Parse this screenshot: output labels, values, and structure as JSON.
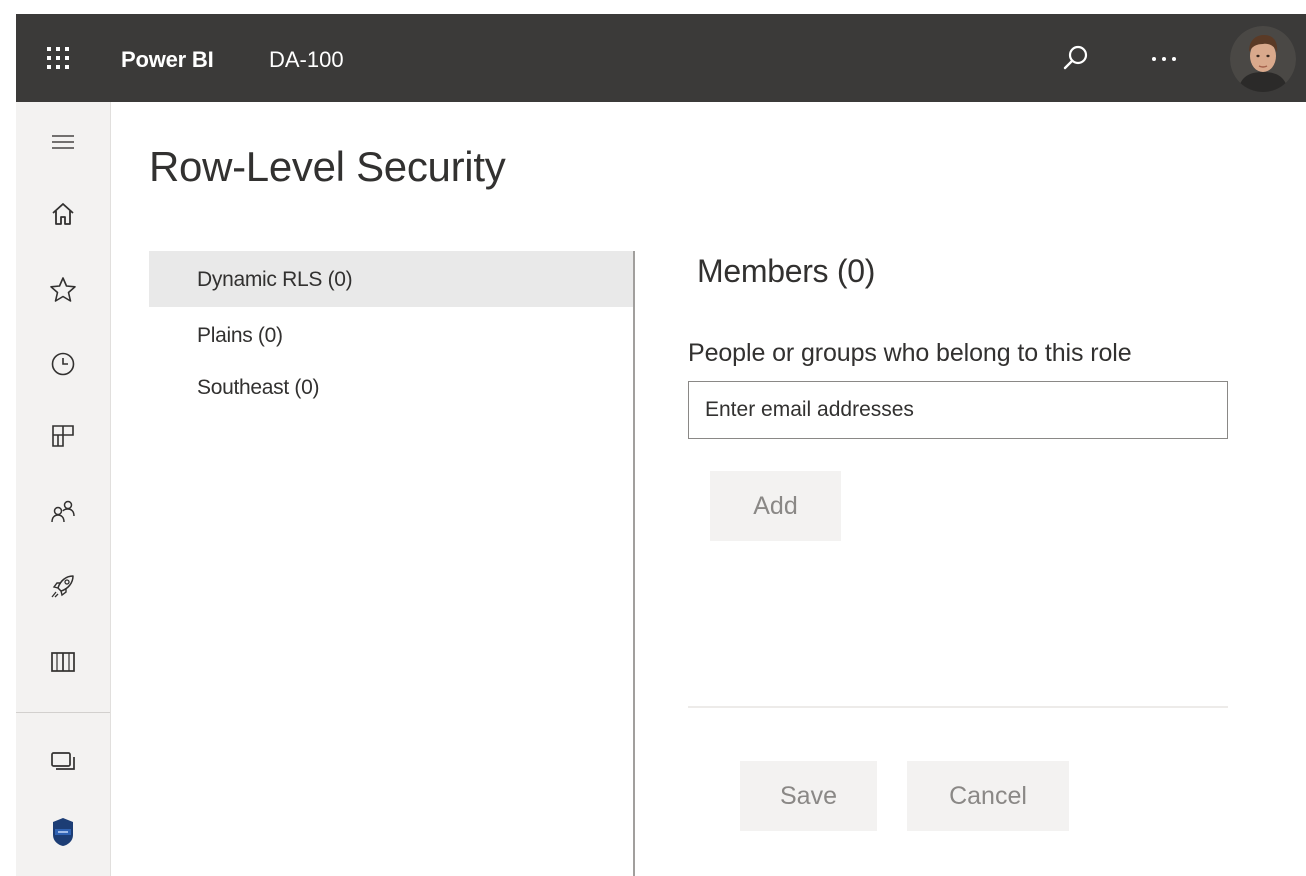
{
  "topbar": {
    "app_name": "Power BI",
    "workspace": "DA-100",
    "icons": {
      "launcher": "app-launcher-waffle-icon",
      "search": "search-icon",
      "more": "more-options-ellipsis-icon",
      "avatar": "user-avatar"
    },
    "background_color": "#3b3a39"
  },
  "leftnav": {
    "items": [
      {
        "name": "navigation-menu",
        "icon": "hamburger-icon"
      },
      {
        "name": "home",
        "icon": "home-icon"
      },
      {
        "name": "favorites",
        "icon": "star-icon"
      },
      {
        "name": "recent",
        "icon": "clock-icon"
      },
      {
        "name": "apps",
        "icon": "apps-icon"
      },
      {
        "name": "shared-with-me",
        "icon": "people-icon"
      },
      {
        "name": "learn",
        "icon": "rocket-icon"
      },
      {
        "name": "workspaces",
        "icon": "book-icon"
      }
    ],
    "bottom_items": [
      {
        "name": "workspace",
        "icon": "monitor-stack-icon"
      },
      {
        "name": "current-workspace",
        "icon": "shield-badge-icon"
      }
    ]
  },
  "page": {
    "title": "Row-Level Security"
  },
  "roles": {
    "items": [
      {
        "label": "Dynamic RLS (0)",
        "selected": true
      },
      {
        "label": "Plains (0)",
        "selected": false
      },
      {
        "label": "Southeast (0)",
        "selected": false
      }
    ]
  },
  "members": {
    "title": "Members (0)",
    "label": "People or groups who belong to this role",
    "input_placeholder": "Enter email addresses",
    "input_value": "",
    "add_label": "Add"
  },
  "footer": {
    "save_label": "Save",
    "cancel_label": "Cancel"
  },
  "colors": {
    "selected_role_bg": "#e9e9e9",
    "button_bg": "#f3f2f1",
    "button_text_disabled": "#8a8886",
    "nav_bg": "#f3f2f1"
  }
}
